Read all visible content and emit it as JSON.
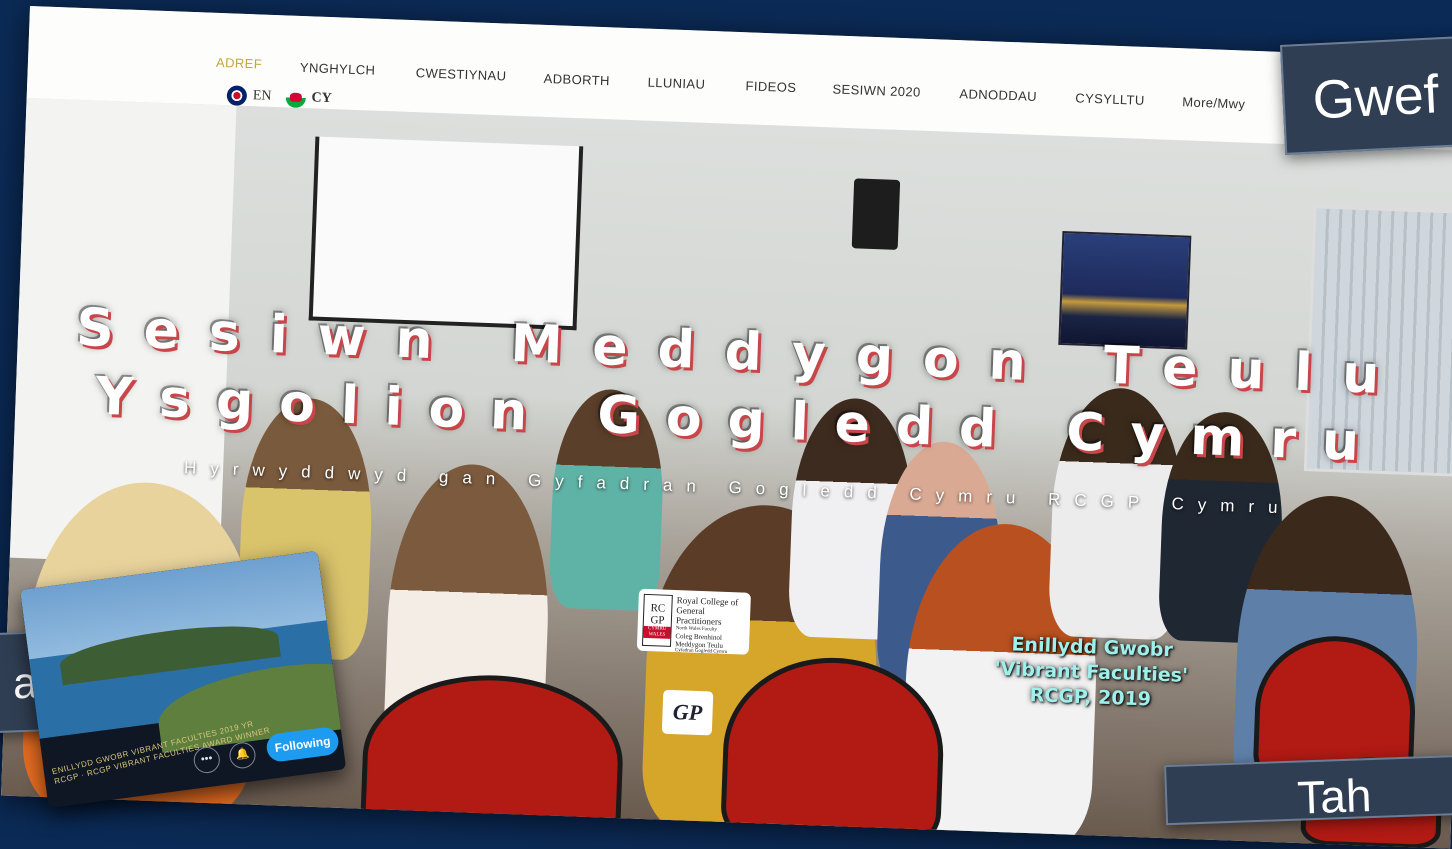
{
  "nav": {
    "items": [
      {
        "label": "ADREF",
        "active": true
      },
      {
        "label": "YNGHYLCH",
        "active": false
      },
      {
        "label": "CWESTIYNAU",
        "active": false
      },
      {
        "label": "ADBORTH",
        "active": false
      },
      {
        "label": "LLUNIAU",
        "active": false
      },
      {
        "label": "FIDEOS",
        "active": false
      },
      {
        "label": "SESIWN 2020",
        "active": false
      },
      {
        "label": "ADNODDAU",
        "active": false
      },
      {
        "label": "CYSYLLTU",
        "active": false
      },
      {
        "label": "More/Mwy",
        "active": false
      }
    ],
    "active_color": "#c8a23a"
  },
  "languages": {
    "en": "EN",
    "cy": "CY"
  },
  "hero": {
    "title_line1": "Sesiwn Meddygon Teulu",
    "title_line2": "Ysgolion Gogledd Cymru",
    "subtitle": "Hyrwyddwyd gan Gyfadran Gogledd Cymru RCGP Cymru",
    "award_line1": "Enillydd Gwobr",
    "award_line2": "'Vibrant Faculties'",
    "award_line3": "RCGP, 2019"
  },
  "logo": {
    "mark_line1": "RC",
    "mark_line2": "GP",
    "mark_line3": "CYMRU WALES",
    "line1": "Royal College of",
    "line2": "General Practitioners",
    "line3": "North Wales Faculty",
    "line4": "Coleg Brenhinol",
    "line5": "Meddygon Teulu",
    "line6": "Cyfadran Gogledd Cymru",
    "gp_text": "GP"
  },
  "overlay_cards": {
    "right": "Gwef",
    "left": "ar",
    "bottom": "Tah"
  },
  "thumbnail": {
    "caption": "ENILLYDD GWOBR VIBRANT FACULTIES 2019 YR RCGP · RCGP VIBRANT FACULTIES AWARD WINNER",
    "more_glyph": "•••",
    "notify_glyph": "🔔",
    "follow_label": "Following"
  }
}
